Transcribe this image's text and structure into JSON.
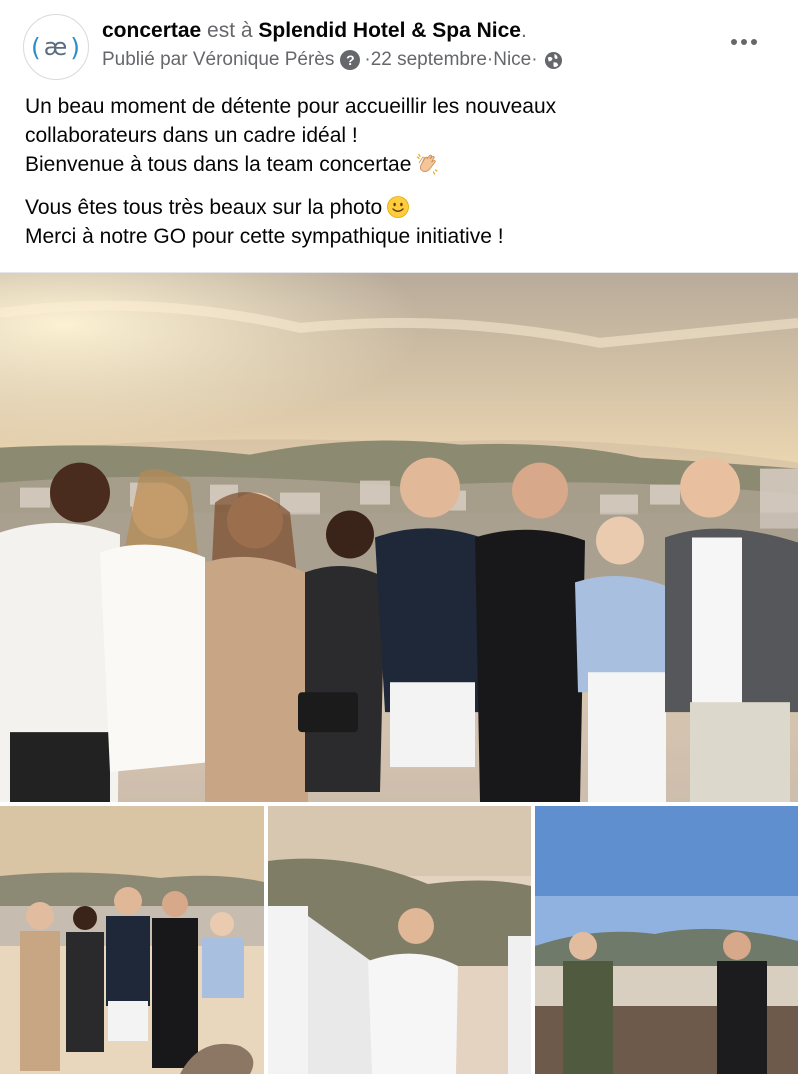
{
  "post": {
    "author": "concertae",
    "connector": " est à ",
    "place": "Splendid Hotel & Spa Nice",
    "period": ".",
    "published_by": "Publié par Véronique Pérès",
    "separator": " · ",
    "date": "22 septembre",
    "location": "Nice",
    "avatar_text": {
      "open": "(",
      "ae": "æ",
      "close": ")"
    },
    "more_icon": "more-horizontal-icon",
    "privacy_icon": "globe-icon",
    "help_icon": "question-mark-icon"
  },
  "body": {
    "paragraph1": {
      "line1": "Un beau moment de détente pour accueillir les nouveaux",
      "line2": "collaborateurs dans un cadre idéal !",
      "line3": "Bienvenue à tous dans la team concertae",
      "line3_emoji": "clapping-hands-emoji"
    },
    "paragraph2": {
      "line1": "Vous êtes tous très beaux sur la photo",
      "line1_emoji": "slightly-smiling-face-emoji",
      "line2": "Merci à notre GO pour cette sympathique initiative !"
    }
  },
  "photos": {
    "main": "group-photo-rooftop-sunset",
    "thumbs": [
      "group-photo-with-dog",
      "man-speaking-on-terrace",
      "two-men-on-rooftop-bar"
    ]
  },
  "colors": {
    "text": "#050505",
    "muted": "#65676b",
    "brand_blue": "#2f8fc4"
  }
}
